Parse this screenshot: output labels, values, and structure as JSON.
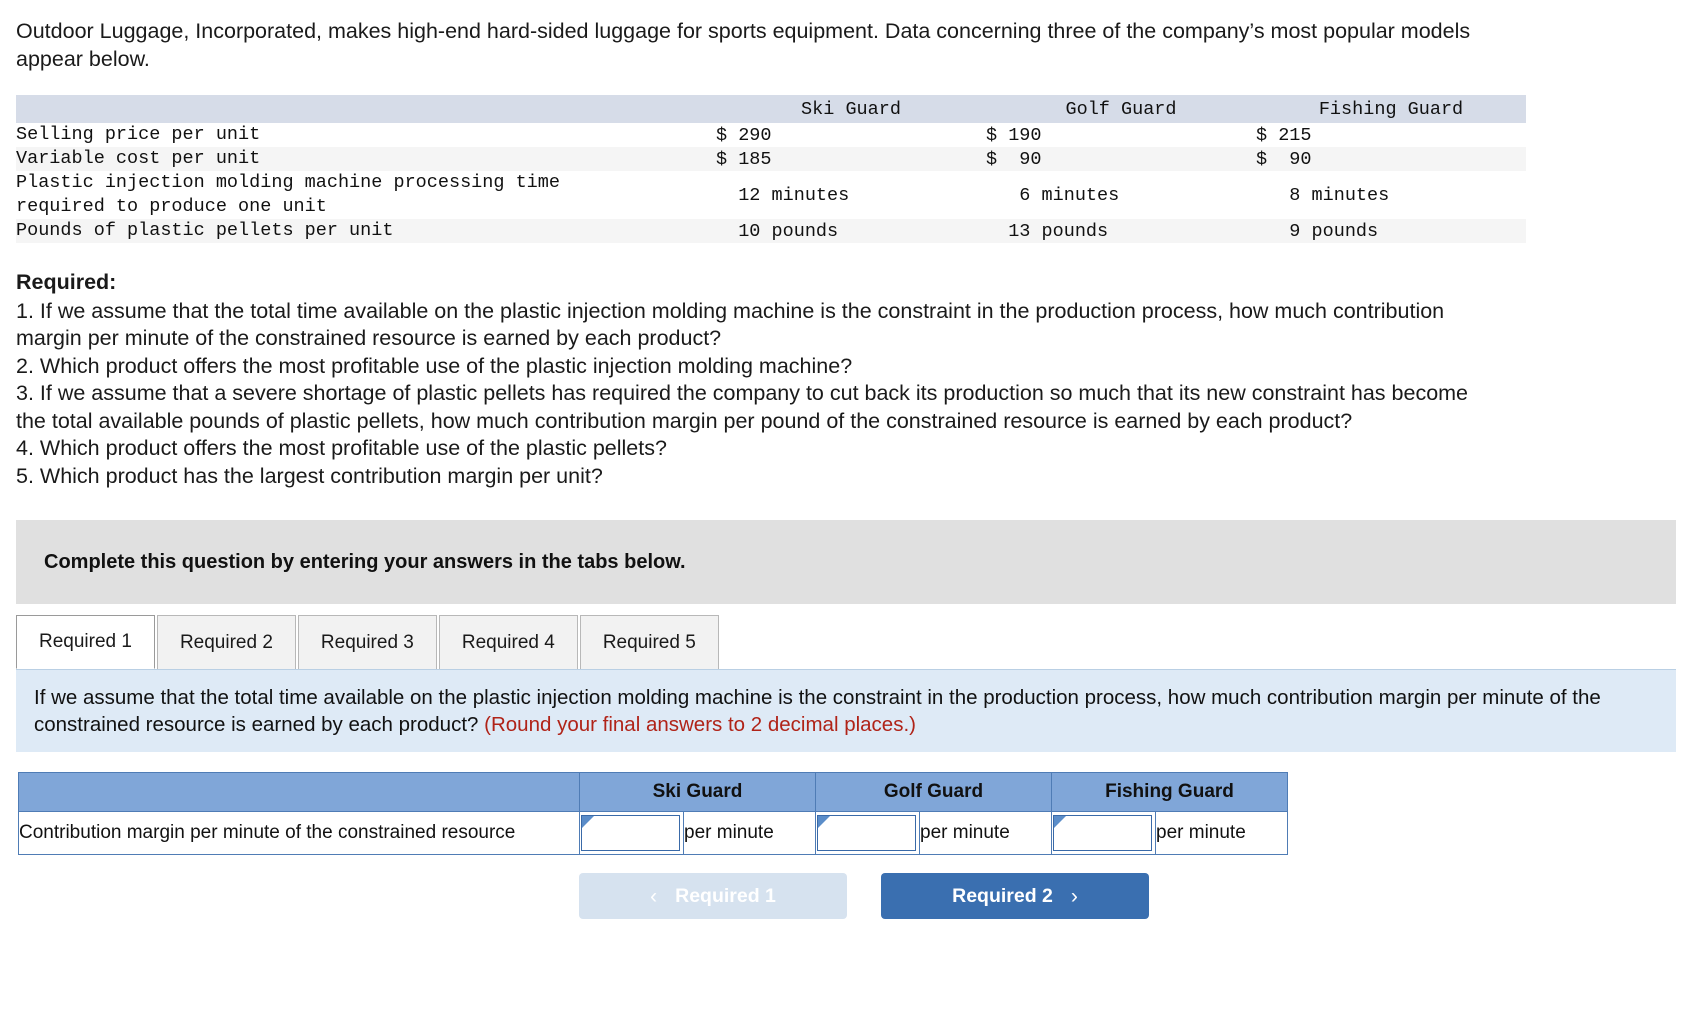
{
  "intro": {
    "paragraph": "Outdoor Luggage, Incorporated, makes high-end hard-sided luggage for sports equipment. Data concerning three of the company’s most popular models appear below."
  },
  "data_table": {
    "blank_header": "",
    "columns": [
      "Ski Guard",
      "Golf Guard",
      "Fishing Guard"
    ],
    "rows": [
      {
        "label": "Selling price per unit",
        "values": [
          "$ 290",
          "$ 190",
          "$ 215"
        ]
      },
      {
        "label": "Variable cost per unit",
        "values": [
          "$ 185",
          "$  90",
          "$  90"
        ]
      },
      {
        "label": "Plastic injection molding machine processing time\n  required to produce one unit",
        "values": [
          "  12 minutes",
          "   6 minutes",
          "   8 minutes"
        ]
      },
      {
        "label": "Pounds of plastic pellets per unit",
        "values": [
          "  10 pounds",
          "  13 pounds",
          "   9 pounds"
        ]
      }
    ]
  },
  "required": {
    "heading": "Required:",
    "items": [
      "1. If we assume that the total time available on the plastic injection molding machine is the constraint in the production process, how much contribution margin per minute of the constrained resource is earned by each product?",
      "2. Which product offers the most profitable use of the plastic injection molding machine?",
      "3. If we assume that a severe shortage of plastic pellets has required the company to cut back its production so much that its new constraint has become the total available pounds of plastic pellets, how much contribution margin per pound of the constrained resource is earned by each product?",
      "4. Which product offers the most profitable use of the plastic pellets?",
      "5. Which product has the largest contribution margin per unit?"
    ]
  },
  "banner": {
    "text": "Complete this question by entering your answers in the tabs below."
  },
  "tabs": [
    {
      "label": "Required 1",
      "active": true
    },
    {
      "label": "Required 2",
      "active": false
    },
    {
      "label": "Required 3",
      "active": false
    },
    {
      "label": "Required 4",
      "active": false
    },
    {
      "label": "Required 5",
      "active": false
    }
  ],
  "question_panel": {
    "text": "If we assume that the total time available on the plastic injection molding machine is the constraint in the production process, how much contribution margin per minute of the constrained resource is earned by each product?",
    "round_note": "(Round your final answers to 2 decimal places.)",
    "note_color": "#b02318"
  },
  "answer_table": {
    "header_blank": "",
    "headers": [
      "Ski Guard",
      "Golf Guard",
      "Fishing Guard"
    ],
    "row_label": "Contribution margin per minute of the constrained resource",
    "cells": [
      {
        "value": "",
        "unit": "per minute"
      },
      {
        "value": "",
        "unit": "per minute"
      },
      {
        "value": "",
        "unit": "per minute"
      }
    ],
    "header_bg": "#80a6d8"
  },
  "nav": {
    "prev_label": "Required 1",
    "prev_chevron": "‹",
    "next_label": "Required 2",
    "next_chevron": "›",
    "prev_bg": "#d6e2ef",
    "next_bg": "#3a6fb0"
  }
}
